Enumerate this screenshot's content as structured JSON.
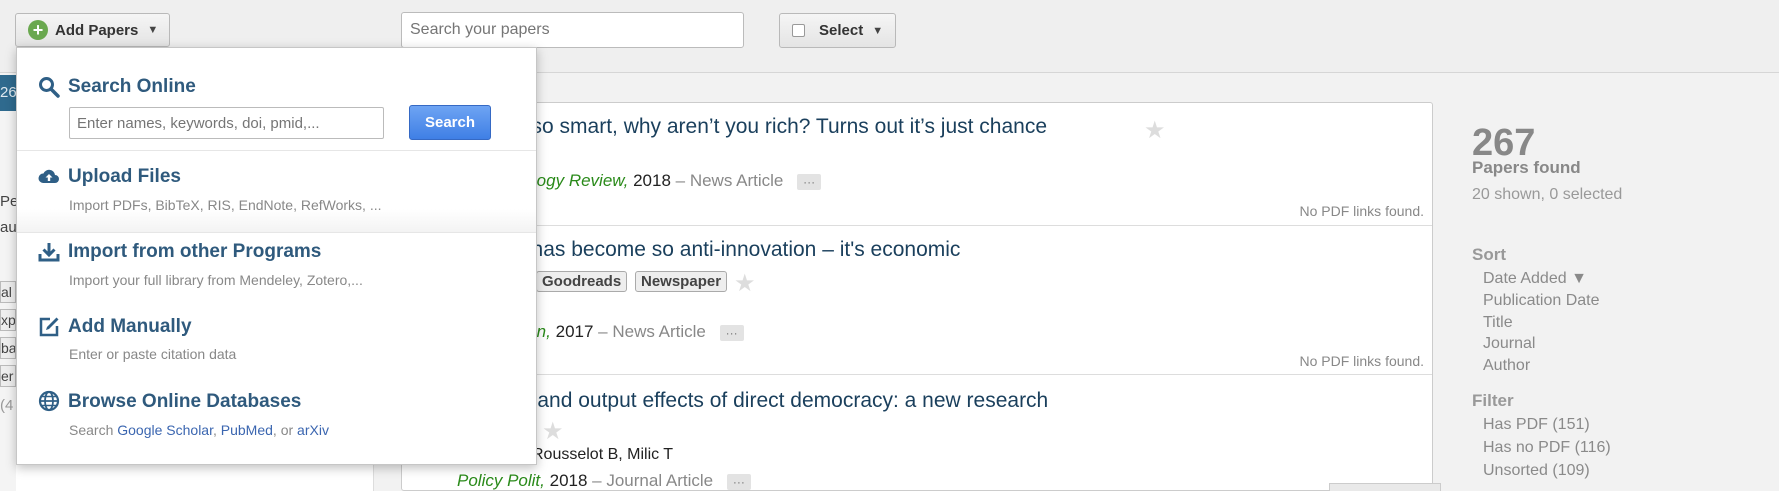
{
  "toolbar": {
    "add_papers_label": "Add Papers",
    "search_placeholder": "Search your papers",
    "select_label": "Select"
  },
  "left_fragments": {
    "badge": "26",
    "line1": "Pe",
    "line2": "aus",
    "tags": [
      "al",
      "xp",
      "ba",
      "er"
    ],
    "count": "(4"
  },
  "add_menu": {
    "search_online": {
      "title": "Search Online",
      "placeholder": "Enter names, keywords, doi, pmid,...",
      "button": "Search"
    },
    "upload": {
      "title": "Upload Files",
      "desc": "Import PDFs, BibTeX, RIS, EndNote, RefWorks, ..."
    },
    "import": {
      "title": "Import from other Programs",
      "desc": "Import your full library from Mendeley, Zotero,..."
    },
    "manual": {
      "title": "Add Manually",
      "desc": "Enter or paste citation data"
    },
    "browse": {
      "title": "Browse Online Databases",
      "desc_prefix": "Search ",
      "link1": "Google Scholar",
      "sep1": ", ",
      "link2": "PubMed",
      "sep2": ", or ",
      "link3": "arXiv"
    }
  },
  "papers": [
    {
      "title": "e so smart, why aren’t you rich? Turns out it’s just chance",
      "journal": "nology Review,",
      "year": "2018",
      "type": "– News Article",
      "dots": "···",
      "pdf_status": "No PDF links found."
    },
    {
      "title": "a has become so anti-innovation – it's economic",
      "tags": [
        "Goodreads",
        "Newspaper"
      ],
      "journal": "dian,",
      "year": "2017",
      "type": "– News Article",
      "dots": "···",
      "pdf_status": "No PDF links found."
    },
    {
      "title": "ut and output effects of direct democracy: a new research",
      "authors": "Rousselot B, Milic T",
      "journal": "Policy Polit,",
      "year": "2018",
      "type": "– Journal Article",
      "dots": "···"
    }
  ],
  "sidebar": {
    "count": "267",
    "found_label": "Papers found",
    "shown_label": "20 shown, 0 selected",
    "sort_heading": "Sort",
    "sort_options": [
      "Date Added ▼",
      "Publication Date",
      "Title",
      "Journal",
      "Author"
    ],
    "filter_heading": "Filter",
    "filter_options": [
      "Has PDF (151)",
      "Has no PDF (116)",
      "Unsorted (109)"
    ]
  }
}
